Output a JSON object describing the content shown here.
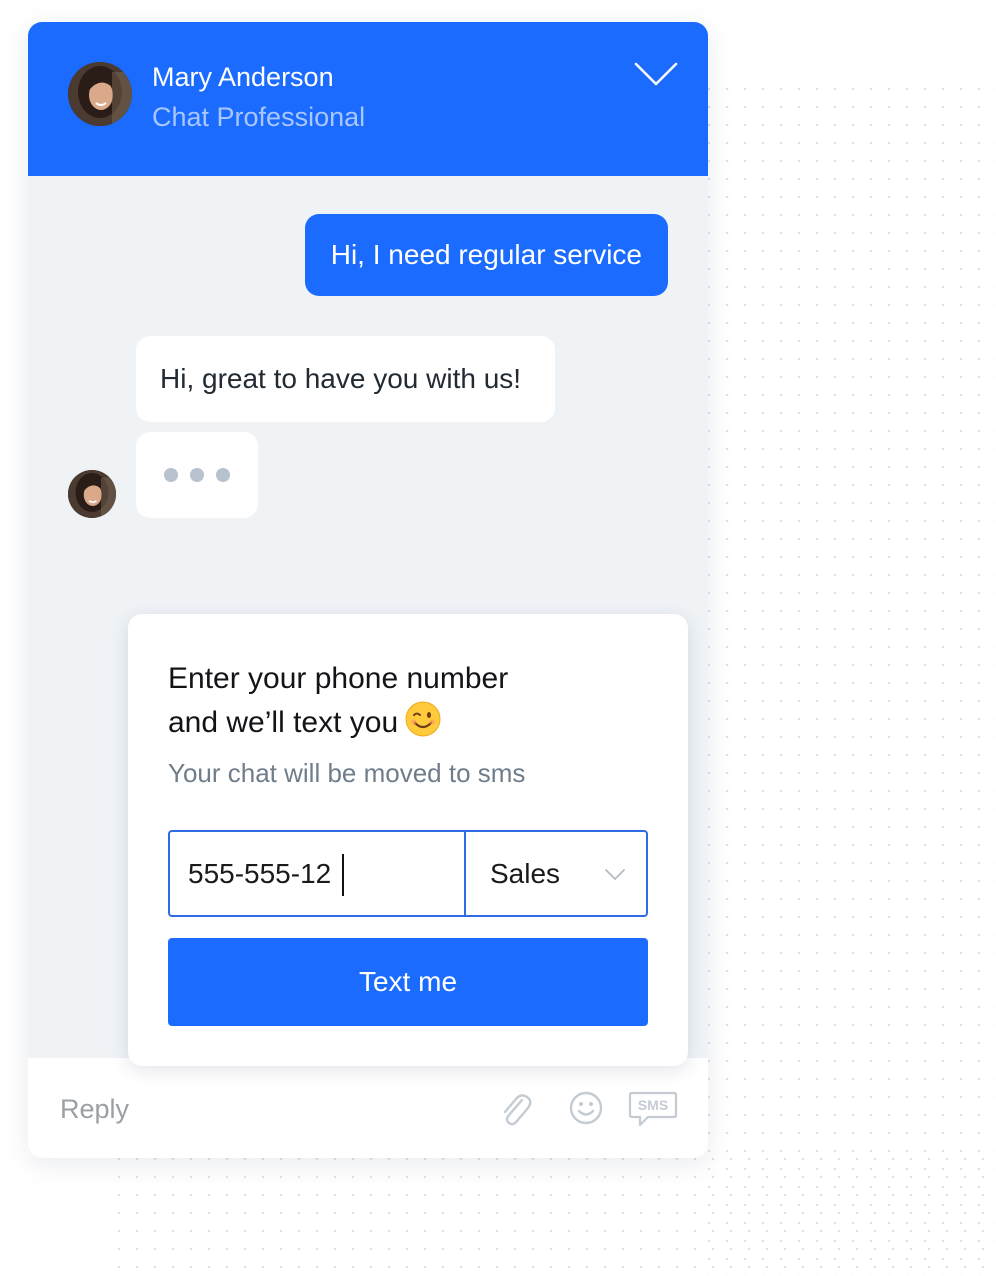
{
  "header": {
    "agent_name": "Mary Anderson",
    "agent_role": "Chat Professional",
    "collapse_icon": "chevron-down-icon"
  },
  "messages": [
    {
      "from": "user",
      "text": "Hi, I need regular service"
    },
    {
      "from": "agent",
      "text": "Hi, great to have you with us!"
    }
  ],
  "typing_indicator": {
    "visible": true,
    "dots": 3
  },
  "sms_card": {
    "title_line1": "Enter your phone number",
    "title_line2": "and we’ll text you",
    "title_emoji_icon": "winking-face-icon",
    "subtitle": "Your chat will be moved to sms",
    "phone_value": "555-555-12",
    "department": "Sales",
    "button_label": "Text me"
  },
  "reply_bar": {
    "placeholder": "Reply",
    "icons": [
      "paperclip-icon",
      "smiley-icon",
      "sms-icon"
    ],
    "sms_icon_label": "SMS"
  },
  "colors": {
    "brand_blue": "#1b6bff",
    "chat_background": "#eff3f6",
    "header_subtitle": "#a8c6ff",
    "muted_text": "#6f7d8a"
  }
}
